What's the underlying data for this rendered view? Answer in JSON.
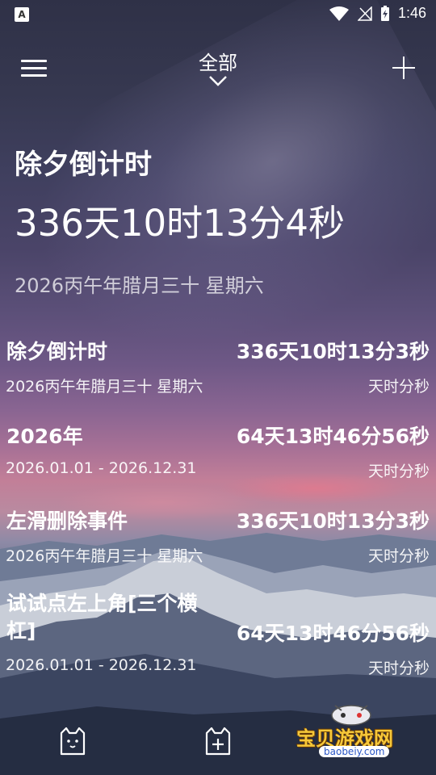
{
  "status_bar": {
    "time": "1:46",
    "left_icon": "A"
  },
  "header": {
    "title": "全部"
  },
  "hero": {
    "title": "除夕倒计时",
    "countdown": "336天10时13分4秒",
    "date": "2026丙午年腊月三十 星期六"
  },
  "events": [
    {
      "title": "除夕倒计时",
      "countdown": "336天10时13分3秒",
      "date": "2026丙午年腊月三十 星期六",
      "unit": "天时分秒"
    },
    {
      "title": "2026年",
      "countdown": "64天13时46分56秒",
      "date": "2026.01.01 - 2026.12.31",
      "unit": "天时分秒"
    },
    {
      "title": "左滑删除事件",
      "countdown": "336天10时13分3秒",
      "date": "2026丙午年腊月三十 星期六",
      "unit": "天时分秒"
    },
    {
      "title": "试试点左上角[三个横杠]",
      "countdown": "64天13时46分56秒",
      "date": "2026.01.01 - 2026.12.31",
      "unit": "天时分秒"
    }
  ],
  "watermark": {
    "name": "宝贝游戏网",
    "url": "baobeiy.com"
  }
}
